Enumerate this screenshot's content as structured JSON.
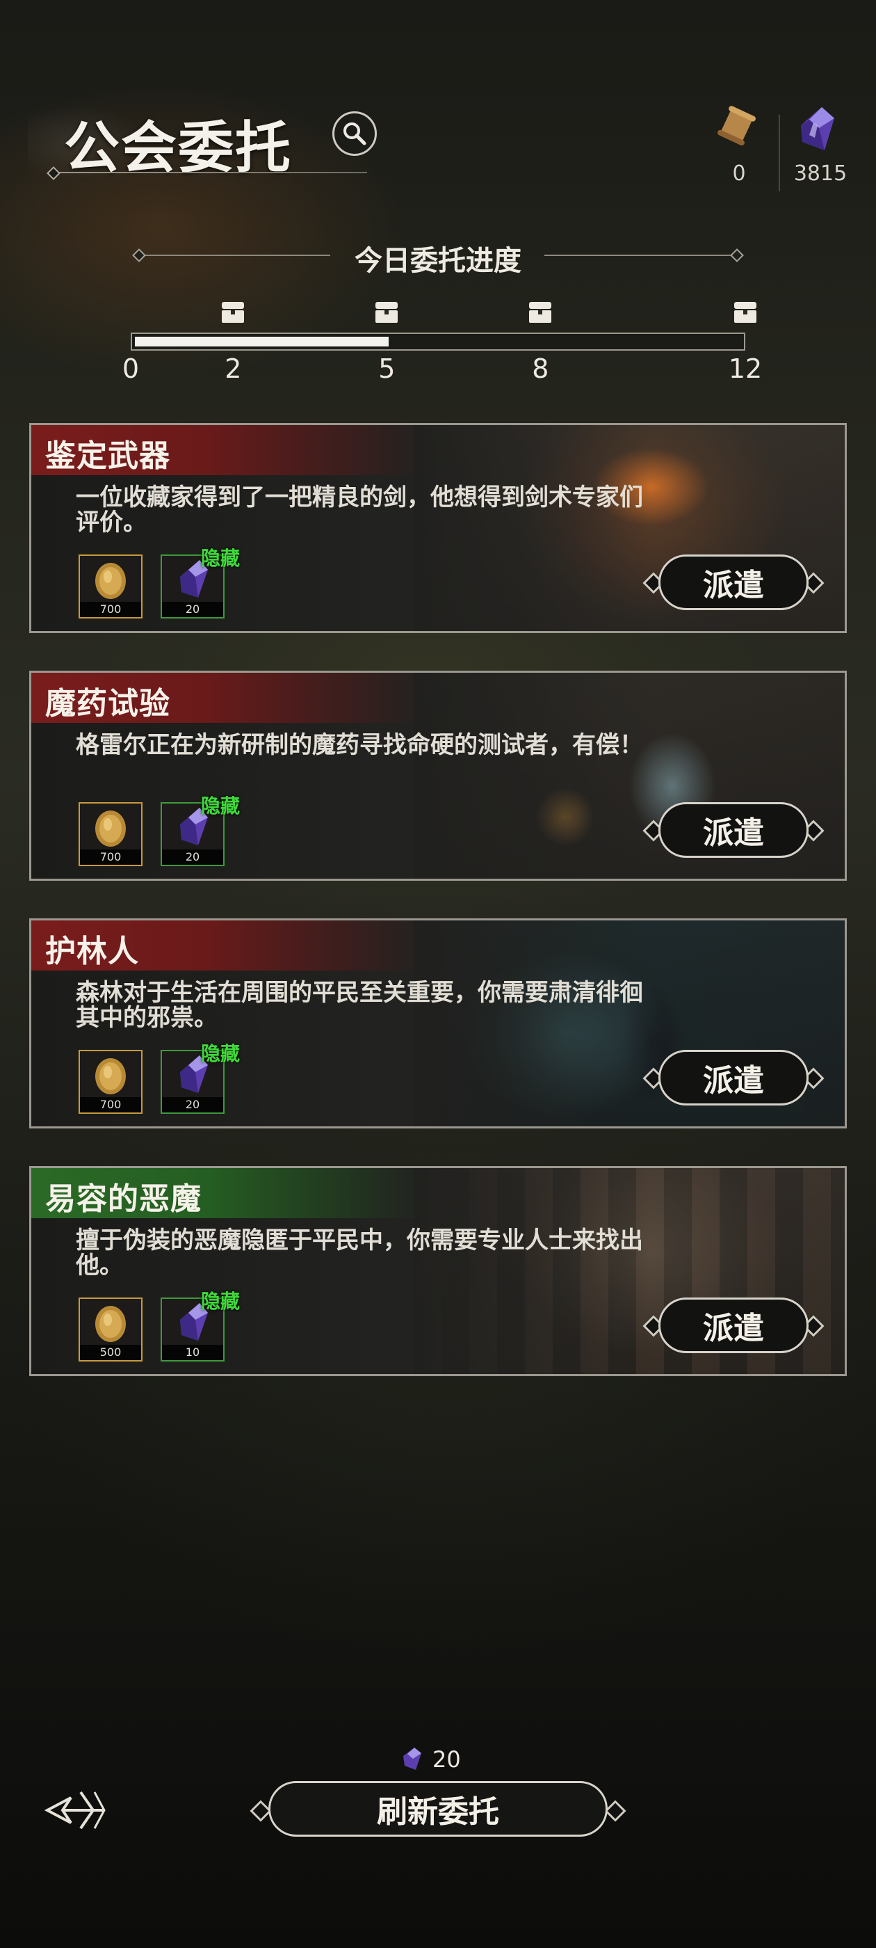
{
  "header": {
    "title": "公会委托",
    "resources": [
      {
        "icon": "scroll-icon",
        "value": "0"
      },
      {
        "icon": "crystal-icon",
        "value": "3815"
      }
    ]
  },
  "progress": {
    "title": "今日委托进度",
    "current": 5,
    "max": 12,
    "labels": [
      "0",
      "2",
      "5",
      "8",
      "12"
    ],
    "chests": [
      2,
      5,
      8,
      12
    ]
  },
  "commissions": [
    {
      "title": "鉴定武器",
      "desc": "一位收藏家得到了一把精良的剑，他想得到剑术专家们评价。",
      "gold": "700",
      "crystal": "20",
      "hidden_label": "隐藏",
      "button": "派遣",
      "tag_color": "#7a1c1c"
    },
    {
      "title": "魔药试验",
      "desc": "格雷尔正在为新研制的魔药寻找命硬的测试者，有偿！",
      "gold": "700",
      "crystal": "20",
      "hidden_label": "隐藏",
      "button": "派遣",
      "tag_color": "#7a1c1c"
    },
    {
      "title": "护林人",
      "desc": "森林对于生活在周围的平民至关重要，你需要肃清徘徊其中的邪祟。",
      "gold": "700",
      "crystal": "20",
      "hidden_label": "隐藏",
      "button": "派遣",
      "tag_color": "#7a1c1c"
    },
    {
      "title": "易容的恶魔",
      "desc": "擅于伪装的恶魔隐匿于平民中，你需要专业人士来找出他。",
      "gold": "500",
      "crystal": "10",
      "hidden_label": "隐藏",
      "button": "派遣",
      "tag_color": "#2a6a26"
    }
  ],
  "footer": {
    "refresh_cost": "20",
    "refresh_label": "刷新委托"
  }
}
